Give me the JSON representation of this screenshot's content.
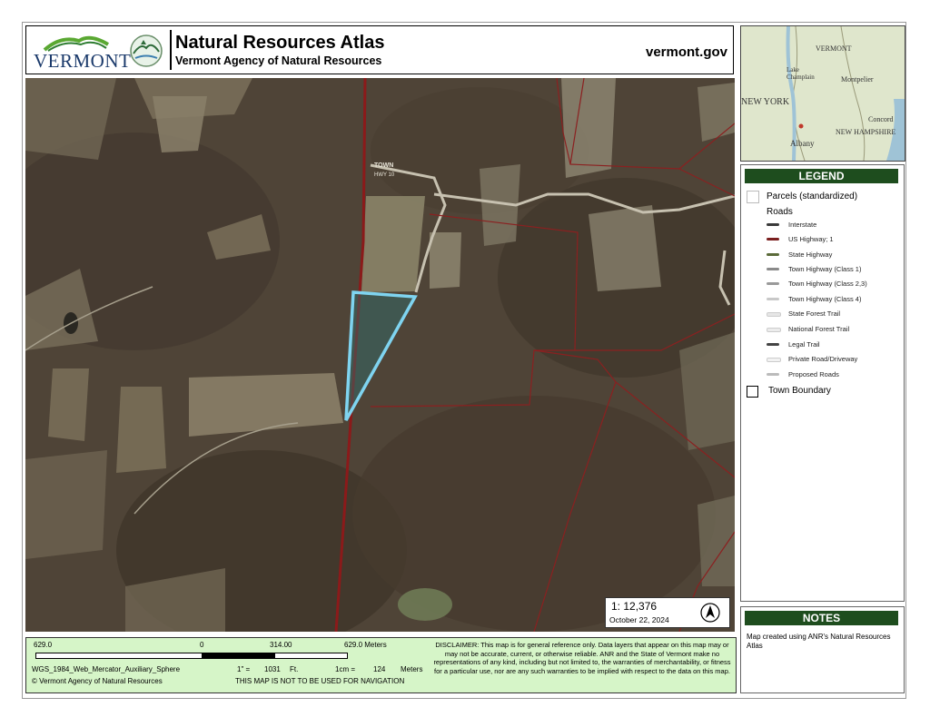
{
  "header": {
    "logo_text": "VERMONT",
    "title": "Natural Resources Atlas",
    "subtitle": "Vermont Agency of Natural Resources",
    "website": "vermont.gov"
  },
  "map": {
    "road_label_1": "TOWN",
    "road_label_2": "HWY 10"
  },
  "scale_box": {
    "ratio": "1:  12,376",
    "date": "October 22, 2024"
  },
  "inset": {
    "labels": [
      "VERMONT",
      "Lake Champlain",
      "Montpelier",
      "NEW YORK",
      "Concord",
      "NEW HAMPSHIRE",
      "Albany"
    ]
  },
  "legend": {
    "title": "LEGEND",
    "parcels": "Parcels (standardized)",
    "roads_heading": "Roads",
    "roads": [
      {
        "label": "Interstate",
        "color": "#3a3a3a"
      },
      {
        "label": "US Highway; 1",
        "color": "#7a1f1f"
      },
      {
        "label": "State Highway",
        "color": "#5b6b3a"
      },
      {
        "label": "Town Highway (Class 1)",
        "color": "#8a8a8a"
      },
      {
        "label": "Town Highway (Class 2,3)",
        "color": "#9a9a9a"
      },
      {
        "label": "Town Highway (Class 4)",
        "color": "#c8c8c8"
      },
      {
        "label": "State Forest Trail",
        "color": "#e6e6e6"
      },
      {
        "label": "National Forest Trail",
        "color": "#ececec"
      },
      {
        "label": "Legal Trail",
        "color": "#444444"
      },
      {
        "label": "Private Road/Driveway",
        "color": "#f2f2f2"
      },
      {
        "label": "Proposed Roads",
        "color": "#bbbbbb"
      }
    ],
    "town_boundary": "Town Boundary"
  },
  "notes": {
    "title": "NOTES",
    "text": "Map created using ANR's Natural Resources Atlas"
  },
  "footer": {
    "scale_left": "629.0",
    "scale_zero": "0",
    "scale_mid": "314.00",
    "scale_right": "629.0 Meters",
    "projection": "WGS_1984_Web_Mercator_Auxiliary_Sphere",
    "copyright": "© Vermont Agency of Natural Resources",
    "inch_label": "1\" =",
    "inch_value": "1031",
    "inch_unit": "Ft.",
    "cm_label": "1cm =",
    "cm_value": "124",
    "cm_unit": "Meters",
    "navigation": "THIS MAP IS NOT TO BE USED FOR NAVIGATION",
    "disclaimer": "DISCLAIMER: This map is for general reference only. Data layers that appear on this map may or may not be accurate, current, or otherwise reliable. ANR and the State of Vermont make no representations of any kind, including but not limited to, the warranties of merchantability, or fitness for a particular use, nor are any such warranties to be implied with respect to the data on this map."
  },
  "colors": {
    "legend_header": "#1e4d1e",
    "footer_bg": "#d6f5c8",
    "parcel_highlight": "#7fd4f0",
    "town_boundary": "#8b1a1a"
  }
}
